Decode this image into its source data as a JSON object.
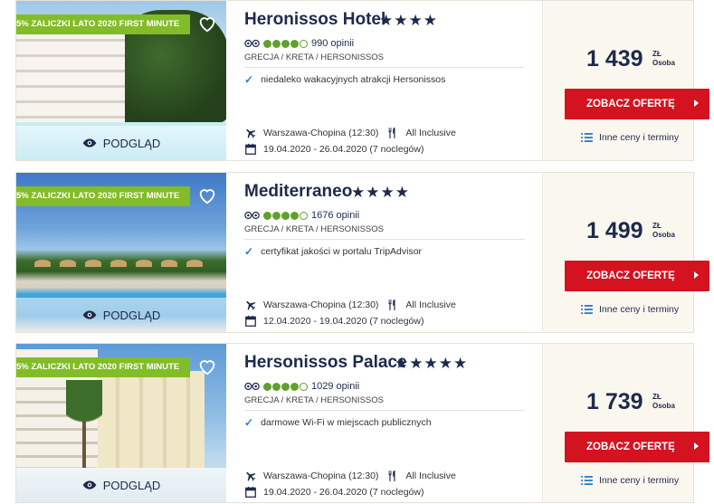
{
  "offers": [
    {
      "promo": "5% ZALICZKI LATO 2020 FIRST MINUTE",
      "preview_label": "PODGLĄD",
      "name": "Heronissos Hotel",
      "stars": "★★★★",
      "rating_bubbles": 4,
      "reviews": "990 opinii",
      "location": "GRECJA / KRETA / HERSONISSOS",
      "feature": "niedaleko wakacyjnych atrakcji Hersonissos",
      "departure": "Warszawa-Chopina (12:30)",
      "board": "All Inclusive",
      "dates": "19.04.2020 - 26.04.2020 (7 noclegów)",
      "price": "1 439",
      "currency": "ZŁ",
      "per": "Osoba",
      "cta": "ZOBACZ OFERTĘ",
      "other_prices": "Inne ceny i terminy"
    },
    {
      "promo": "5% ZALICZKI LATO 2020 FIRST MINUTE",
      "preview_label": "PODGLĄD",
      "name": "Mediterraneo",
      "stars": "★★★★",
      "rating_bubbles": 4,
      "reviews": "1676 opinii",
      "location": "GRECJA / KRETA / HERSONISSOS",
      "feature": "certyfikat jakości w portalu TripAdvisor",
      "departure": "Warszawa-Chopina (12:30)",
      "board": "All Inclusive",
      "dates": "12.04.2020 - 19.04.2020 (7 noclegów)",
      "price": "1 499",
      "currency": "ZŁ",
      "per": "Osoba",
      "cta": "ZOBACZ OFERTĘ",
      "other_prices": "Inne ceny i terminy"
    },
    {
      "promo": "5% ZALICZKI LATO 2020 FIRST MINUTE",
      "preview_label": "PODGLĄD",
      "name": "Hersonissos Palace",
      "stars": "★★★★★",
      "rating_bubbles": 4,
      "reviews": "1029 opinii",
      "location": "GRECJA / KRETA / HERSONISSOS",
      "feature": "darmowe Wi-Fi w miejscach publicznych",
      "departure": "Warszawa-Chopina (12:30)",
      "board": "All Inclusive",
      "dates": "19.04.2020 - 26.04.2020 (7 noclegów)",
      "price": "1 739",
      "currency": "ZŁ",
      "per": "Osoba",
      "cta": "ZOBACZ OFERTĘ",
      "other_prices": "Inne ceny i terminy"
    }
  ],
  "icons": {
    "favorite": "heart-outline-icon",
    "preview": "eye-icon",
    "flight": "plane-icon",
    "board": "fork-knife-icon",
    "dates": "calendar-icon",
    "feature": "checkmark-icon",
    "other": "list-icon",
    "cta_arrow": "chevron-right-icon"
  },
  "colors": {
    "navy": "#1d2a4d",
    "promo_green": "#82bc27",
    "cta_red": "#d5121f",
    "link_blue": "#2a7bc7",
    "price_bg": "#faf7ef",
    "tripadvisor_green": "#5fa12a"
  }
}
